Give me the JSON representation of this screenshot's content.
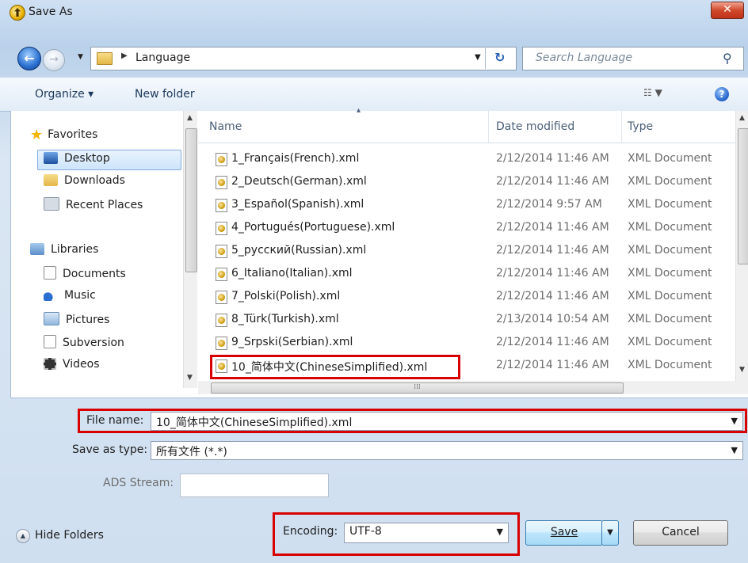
{
  "window": {
    "title": "Save As",
    "close_label": "✕"
  },
  "address": {
    "path": "Language"
  },
  "search": {
    "placeholder": "Search Language"
  },
  "toolbar": {
    "organize": "Organize ▾",
    "new_folder": "New folder"
  },
  "nav": {
    "favorites": "Favorites",
    "desktop": "Desktop",
    "downloads": "Downloads",
    "recent": "Recent Places",
    "libraries": "Libraries",
    "documents": "Documents",
    "music": "Music",
    "pictures": "Pictures",
    "subversion": "Subversion",
    "videos": "Videos"
  },
  "columns": {
    "name": "Name",
    "date": "Date modified",
    "type": "Type"
  },
  "files": [
    {
      "name": "1_Français(French).xml",
      "date": "2/12/2014 11:46 AM",
      "type": "XML Document"
    },
    {
      "name": "2_Deutsch(German).xml",
      "date": "2/12/2014 11:46 AM",
      "type": "XML Document"
    },
    {
      "name": "3_Español(Spanish).xml",
      "date": "2/12/2014 9:57 AM",
      "type": "XML Document"
    },
    {
      "name": "4_Portugués(Portuguese).xml",
      "date": "2/12/2014 11:46 AM",
      "type": "XML Document"
    },
    {
      "name": "5_русский(Russian).xml",
      "date": "2/12/2014 11:46 AM",
      "type": "XML Document"
    },
    {
      "name": "6_Italiano(Italian).xml",
      "date": "2/12/2014 11:46 AM",
      "type": "XML Document"
    },
    {
      "name": "7_Polski(Polish).xml",
      "date": "2/12/2014 11:46 AM",
      "type": "XML Document"
    },
    {
      "name": "8_Türk(Turkish).xml",
      "date": "2/13/2014 10:54 AM",
      "type": "XML Document"
    },
    {
      "name": "9_Srpski(Serbian).xml",
      "date": "2/12/2014 11:46 AM",
      "type": "XML Document"
    },
    {
      "name": "10_简体中文(ChineseSimplified).xml",
      "date": "2/12/2014 11:46 AM",
      "type": "XML Document"
    }
  ],
  "form": {
    "file_name_label": "File name:",
    "file_name_value": "10_简体中文(ChineseSimplified).xml",
    "save_type_label": "Save as type:",
    "save_type_value": "所有文件 (*.*)",
    "ads_label": "ADS Stream:",
    "ads_value": "",
    "encoding_label": "Encoding:",
    "encoding_value": "UTF-8"
  },
  "buttons": {
    "hide_folders": "Hide Folders",
    "save": "Save",
    "cancel": "Cancel"
  },
  "colors": {
    "highlight_box": "#d80000",
    "accent": "#2a6fd0"
  }
}
